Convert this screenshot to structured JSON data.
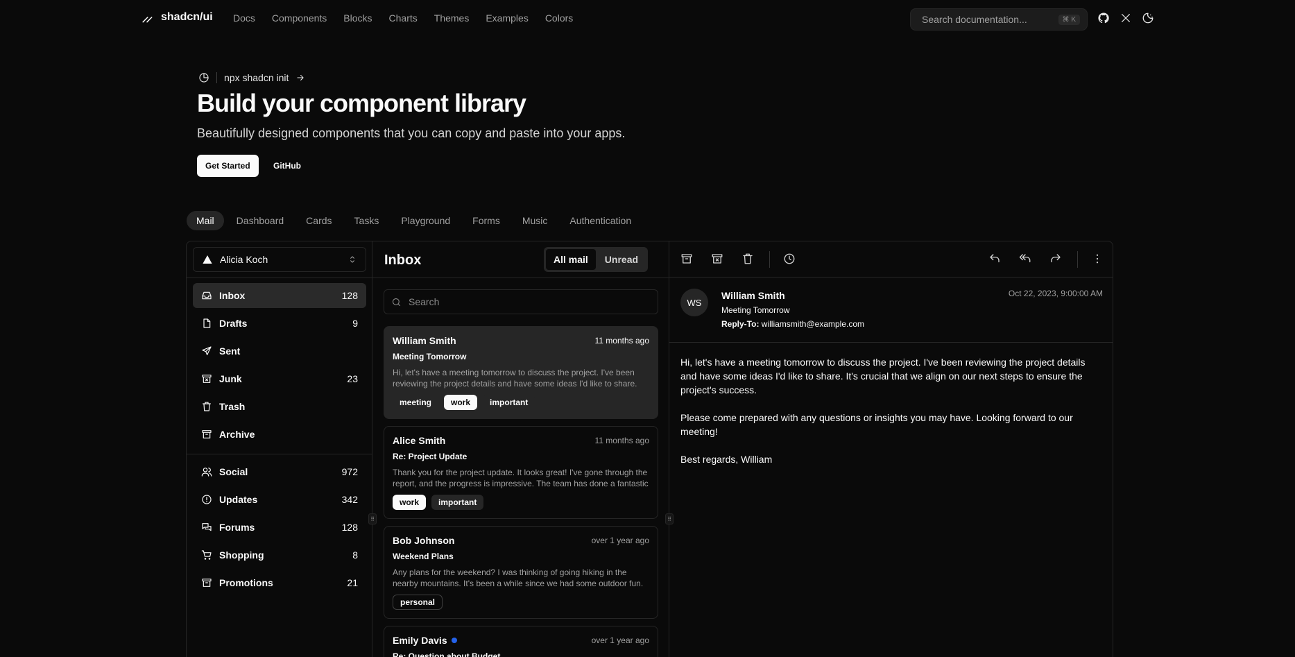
{
  "brand": {
    "name": "shadcn/ui"
  },
  "nav": [
    "Docs",
    "Components",
    "Blocks",
    "Charts",
    "Themes",
    "Examples",
    "Colors"
  ],
  "search": {
    "placeholder": "Search documentation...",
    "shortcut": "⌘ K"
  },
  "hero": {
    "announcement": "npx shadcn init",
    "title": "Build your component library",
    "subtitle": "Beautifully designed components that you can copy and paste into your apps.",
    "primary_cta": "Get Started",
    "secondary_cta": "GitHub"
  },
  "example_tabs": [
    "Mail",
    "Dashboard",
    "Cards",
    "Tasks",
    "Playground",
    "Forms",
    "Music",
    "Authentication"
  ],
  "mail": {
    "account": "Alicia Koch",
    "folders": [
      {
        "label": "Inbox",
        "count": "128",
        "icon": "inbox-icon"
      },
      {
        "label": "Drafts",
        "count": "9",
        "icon": "file-icon"
      },
      {
        "label": "Sent",
        "count": "",
        "icon": "send-icon"
      },
      {
        "label": "Junk",
        "count": "23",
        "icon": "archive-x-icon"
      },
      {
        "label": "Trash",
        "count": "",
        "icon": "trash-icon"
      },
      {
        "label": "Archive",
        "count": "",
        "icon": "archive-icon"
      }
    ],
    "categories": [
      {
        "label": "Social",
        "count": "972",
        "icon": "users-icon"
      },
      {
        "label": "Updates",
        "count": "342",
        "icon": "alert-circle-icon"
      },
      {
        "label": "Forums",
        "count": "128",
        "icon": "messages-icon"
      },
      {
        "label": "Shopping",
        "count": "8",
        "icon": "cart-icon"
      },
      {
        "label": "Promotions",
        "count": "21",
        "icon": "archive-icon"
      }
    ],
    "list_title": "Inbox",
    "filters": [
      "All mail",
      "Unread"
    ],
    "search_placeholder": "Search",
    "messages": [
      {
        "from": "William Smith",
        "time": "11 months ago",
        "subject": "Meeting Tomorrow",
        "preview": "Hi, let's have a meeting tomorrow to discuss the project. I've been reviewing the project details and have some ideas I'd like to share. It's crucial that we align on our next steps to ensure the project's success.",
        "tags": [
          "meeting",
          "work",
          "important"
        ]
      },
      {
        "from": "Alice Smith",
        "time": "11 months ago",
        "subject": "Re: Project Update",
        "preview": "Thank you for the project update. It looks great! I've gone through the report, and the progress is impressive. The team has done a fantastic job.",
        "tags": [
          "work",
          "important"
        ]
      },
      {
        "from": "Bob Johnson",
        "time": "over 1 year ago",
        "subject": "Weekend Plans",
        "preview": "Any plans for the weekend? I was thinking of going hiking in the nearby mountains. It's been a while since we had some outdoor fun.",
        "tags": [
          "personal"
        ]
      },
      {
        "from": "Emily Davis",
        "time": "over 1 year ago",
        "subject": "Re: Question about Budget",
        "preview": "",
        "tags": []
      }
    ],
    "detail": {
      "initials": "WS",
      "from": "William Smith",
      "subject": "Meeting Tomorrow",
      "reply_to_label": "Reply-To:",
      "reply_to": "williamsmith@example.com",
      "date": "Oct 22, 2023, 9:00:00 AM",
      "body": [
        "Hi, let's have a meeting tomorrow to discuss the project. I've been reviewing the project details and have some ideas I'd like to share. It's crucial that we align on our next steps to ensure the project's success.",
        "Please come prepared with any questions or insights you may have. Looking forward to our meeting!",
        "Best regards, William"
      ]
    }
  },
  "colors": {
    "background": "#0a0a0a",
    "card_selected": "#262626",
    "unread_dot": "#2563eb"
  }
}
